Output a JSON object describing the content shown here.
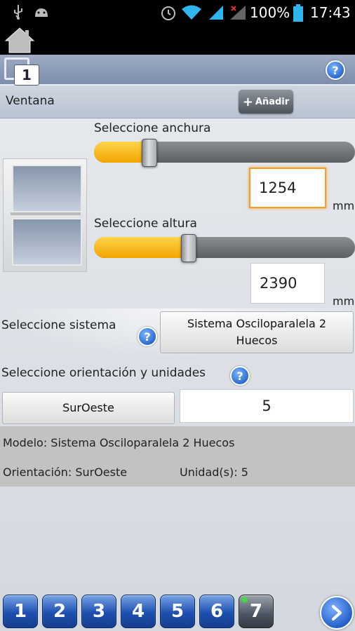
{
  "status_bar": {
    "battery": "100%",
    "time": "17:43",
    "icons": [
      "usb-icon",
      "android-icon",
      "alarm-icon",
      "wifi-icon",
      "signal-icon",
      "signal-x-icon",
      "battery-icon"
    ]
  },
  "toolbar": {
    "home_icon": "home-icon",
    "windows_badge": "1",
    "help_icon": "help-icon"
  },
  "section": {
    "title": "Ventana",
    "add_label": "Añadir",
    "add_icon": "plus-icon"
  },
  "width": {
    "label": "Seleccione anchura",
    "value": "1254",
    "unit": "mm",
    "slider_fraction": 0.21
  },
  "height": {
    "label": "Seleccione altura",
    "value": "2390",
    "unit": "mm",
    "slider_fraction": 0.36
  },
  "system": {
    "label": "Seleccione sistema",
    "button_label": "Sistema Osciloparalela 2 Huecos"
  },
  "orientation": {
    "label": "Seleccione orientación y unidades",
    "orientation_value": "SurOeste",
    "units_value": "5"
  },
  "summary": {
    "model": "Modelo: Sistema Osciloparalela 2 Huecos",
    "orientation": "Orientación: SurOeste",
    "units": "Unidad(s): 5"
  },
  "pager": {
    "pages": [
      "1",
      "2",
      "3",
      "4",
      "5",
      "6",
      "7"
    ],
    "active": "7",
    "next_icon": "chevron-right-icon"
  },
  "colors": {
    "slider_fill": "#f2a400",
    "nav_blue": "#1d4fb0",
    "focus_orange": "#f3a02b"
  }
}
